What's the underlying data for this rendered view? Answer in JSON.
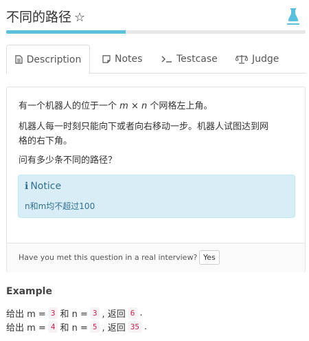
{
  "header": {
    "title": "不同的路径",
    "star": "☆",
    "progress_fraction": 0.4
  },
  "tabs": [
    {
      "label": "Description",
      "icon": "document-icon",
      "active": true
    },
    {
      "label": "Notes",
      "icon": "note-icon",
      "active": false
    },
    {
      "label": "Testcase",
      "icon": "terminal-icon",
      "active": false
    },
    {
      "label": "Judge",
      "icon": "scale-icon",
      "active": false
    }
  ],
  "description": {
    "p1_prefix": "有一个机器人的位于一个",
    "p1_m": "m",
    "p1_times": "×",
    "p1_n": "n",
    "p1_suffix": "个网格左上角。",
    "p2_line1": "机器人每一时刻只能向下或者向右移动一步。机器人试图达到网",
    "p2_line2": "格的右下角。",
    "p3": "问有多少条不同的路径？"
  },
  "notice": {
    "title": "Notice",
    "text": "n和m均不超过100"
  },
  "footer": {
    "question": "Have you met this question in a real interview?",
    "yes_label": "Yes"
  },
  "example": {
    "title": "Example",
    "lines": [
      {
        "prefix": "给出 m =",
        "m": "3",
        "and": "和 n =",
        "n": "3",
        "ret": ", 返回",
        "result": "6",
        "end": "."
      },
      {
        "prefix": "给出 m =",
        "m": "4",
        "and": "和 n =",
        "n": "5",
        "ret": ", 返回",
        "result": "35",
        "end": "."
      }
    ]
  },
  "colors": {
    "accent": "#5bc0de",
    "notice_bg": "#d9edf7",
    "notice_text": "#31708f",
    "code_text": "#c7254e"
  }
}
